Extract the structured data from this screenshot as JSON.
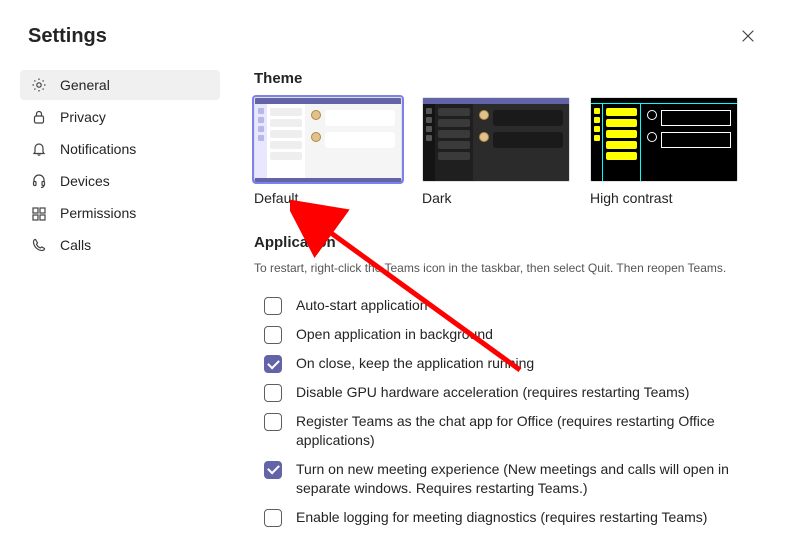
{
  "header": {
    "title": "Settings"
  },
  "sidebar": {
    "items": [
      {
        "id": "general",
        "label": "General",
        "icon": "gear-icon",
        "active": true
      },
      {
        "id": "privacy",
        "label": "Privacy",
        "icon": "lock-icon",
        "active": false
      },
      {
        "id": "notifications",
        "label": "Notifications",
        "icon": "bell-icon",
        "active": false
      },
      {
        "id": "devices",
        "label": "Devices",
        "icon": "headset-icon",
        "active": false
      },
      {
        "id": "permissions",
        "label": "Permissions",
        "icon": "key-icon",
        "active": false
      },
      {
        "id": "calls",
        "label": "Calls",
        "icon": "phone-icon",
        "active": false
      }
    ]
  },
  "theme": {
    "heading": "Theme",
    "options": [
      {
        "id": "default",
        "label": "Default",
        "selected": true
      },
      {
        "id": "dark",
        "label": "Dark",
        "selected": false
      },
      {
        "id": "high_contrast",
        "label": "High contrast",
        "selected": false
      }
    ]
  },
  "application": {
    "heading": "Application",
    "subtext": "To restart, right-click the Teams icon in the taskbar, then select Quit. Then reopen Teams.",
    "options": [
      {
        "id": "auto_start",
        "label": "Auto-start application",
        "checked": false
      },
      {
        "id": "open_bg",
        "label": "Open application in background",
        "checked": false
      },
      {
        "id": "close_run",
        "label": "On close, keep the application running",
        "checked": true
      },
      {
        "id": "disable_gpu",
        "label": "Disable GPU hardware acceleration (requires restarting Teams)",
        "checked": false
      },
      {
        "id": "register",
        "label": "Register Teams as the chat app for Office (requires restarting Office applications)",
        "checked": false
      },
      {
        "id": "new_meeting",
        "label": "Turn on new meeting experience (New meetings and calls will open in separate windows. Requires restarting Teams.)",
        "checked": true
      },
      {
        "id": "logging",
        "label": "Enable logging for meeting diagnostics (requires restarting Teams)",
        "checked": false
      }
    ]
  },
  "annotation": {
    "target": "theme-default"
  }
}
